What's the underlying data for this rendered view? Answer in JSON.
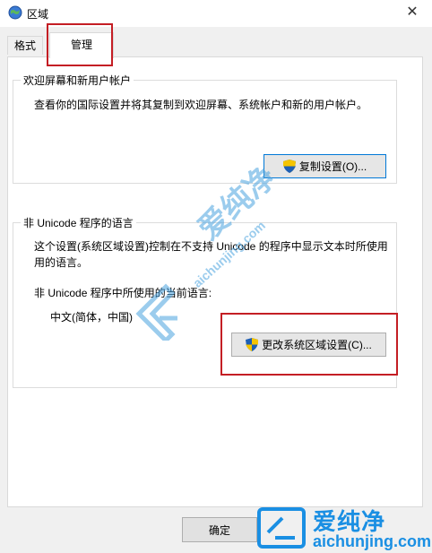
{
  "window": {
    "title": "区域",
    "close_glyph": "✕",
    "icon": "globe-icon"
  },
  "tabs": [
    {
      "label": "格式",
      "active": false
    },
    {
      "label": "管理",
      "active": true
    }
  ],
  "welcome_group": {
    "legend": "欢迎屏幕和新用户帐户",
    "description": "查看你的国际设置并将其复制到欢迎屏幕、系统帐户和新的用户帐户。",
    "copy_button_label": "复制设置(O)..."
  },
  "unicode_group": {
    "legend": "非 Unicode 程序的语言",
    "description_line1": "这个设置(系统区域设置)控制在不支持 Unicode 的程序中显示文本时所使用",
    "description_line2": "用的语言。",
    "current_label": "非 Unicode 程序中所使用的当前语言:",
    "current_value": "中文(简体，中国)",
    "change_button_label": "更改系统区域设置(C)..."
  },
  "footer": {
    "ok_label": "确定"
  },
  "watermark": {
    "logo_text": "爱纯净",
    "url": "aichunjing.com",
    "color": "#1a8fe3"
  },
  "colors": {
    "highlight_red": "#c41e24",
    "focus_blue": "#0078d7"
  }
}
